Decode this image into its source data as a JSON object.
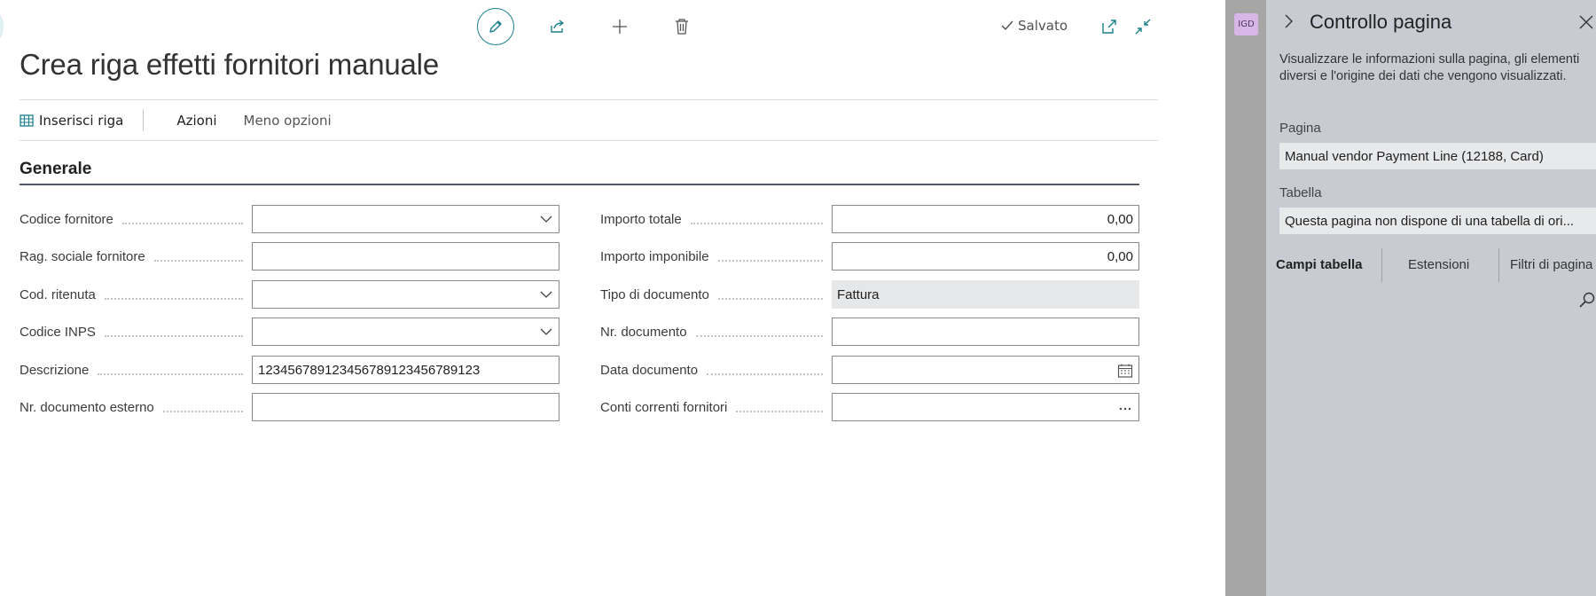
{
  "toolbar": {
    "edit_icon": "pencil-icon",
    "share_icon": "share-icon",
    "add_icon": "plus-icon",
    "delete_icon": "trash-icon",
    "saved_label": "Salvato",
    "popout_icon": "popout-icon",
    "collapse_icon": "collapse-icon"
  },
  "page": {
    "title": "Crea riga effetti fornitori manuale"
  },
  "actions": {
    "insert_row": "Inserisci riga",
    "azioni": "Azioni",
    "meno_opzioni": "Meno opzioni"
  },
  "section": {
    "title": "Generale"
  },
  "left_fields": [
    {
      "label": "Codice fornitore",
      "value": "",
      "type": "dropdown"
    },
    {
      "label": "Rag. sociale fornitore",
      "value": "",
      "type": "text"
    },
    {
      "label": "Cod. ritenuta",
      "value": "",
      "type": "dropdown"
    },
    {
      "label": "Codice INPS",
      "value": "",
      "type": "dropdown"
    },
    {
      "label": "Descrizione",
      "value": "1234567891234567891234567891​23",
      "type": "text"
    },
    {
      "label": "Nr. documento esterno",
      "value": "",
      "type": "text"
    }
  ],
  "right_fields": [
    {
      "label": "Importo totale",
      "value": "0,00",
      "type": "number"
    },
    {
      "label": "Importo imponibile",
      "value": "0,00",
      "type": "number"
    },
    {
      "label": "Tipo di documento",
      "value": "Fattura",
      "type": "readonly"
    },
    {
      "label": "Nr. documento",
      "value": "",
      "type": "text"
    },
    {
      "label": "Data documento",
      "value": "",
      "type": "date"
    },
    {
      "label": "Conti correnti fornitori",
      "value": "",
      "type": "lookup"
    }
  ],
  "panel": {
    "user_badge": "IGD",
    "title": "Controllo pagina",
    "description": "Visualizzare le informazioni sulla pagina, gli elementi diversi e l'origine dei dati che vengono visualizzati.",
    "page_label": "Pagina",
    "page_value": "Manual vendor Payment Line (12188, Card)",
    "table_label": "Tabella",
    "table_value": "Questa pagina non dispone di una tabella di ori...",
    "tabs": [
      "Campi tabella",
      "Estensioni",
      "Filtri di pagina"
    ]
  },
  "colors": {
    "accent": "#1b7f8c",
    "panel_bg": "#c8ccd2",
    "readonly_bg": "#e6e7e8"
  }
}
